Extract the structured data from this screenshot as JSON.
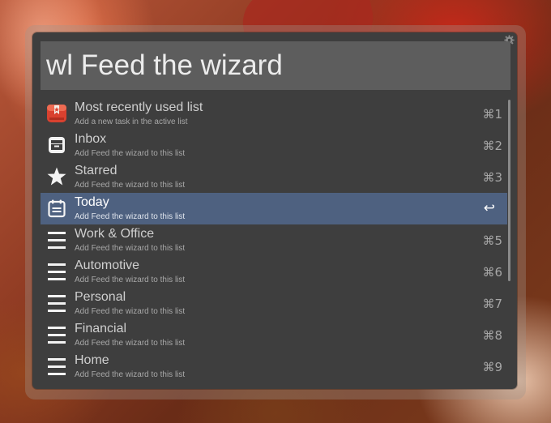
{
  "search": {
    "value": "wl Feed the wizard"
  },
  "icons": {
    "gear": "gear-icon",
    "enter": "↩"
  },
  "results": [
    {
      "title": "Most recently used list",
      "subtitle": "Add a new task in the active list",
      "shortcut": "⌘1",
      "icon": "wunderlist-app-icon"
    },
    {
      "title": "Inbox",
      "subtitle": "Add Feed the wizard to this list",
      "shortcut": "⌘2",
      "icon": "inbox-icon"
    },
    {
      "title": "Starred",
      "subtitle": "Add Feed the wizard to this list",
      "shortcut": "⌘3",
      "icon": "star-icon"
    },
    {
      "title": "Today",
      "subtitle": "Add Feed the wizard to this list",
      "shortcut": "↩",
      "icon": "calendar-icon",
      "selected": true
    },
    {
      "title": "Work & Office",
      "subtitle": "Add Feed the wizard to this list",
      "shortcut": "⌘5",
      "icon": "list-icon"
    },
    {
      "title": "Automotive",
      "subtitle": "Add Feed the wizard to this list",
      "shortcut": "⌘6",
      "icon": "list-icon"
    },
    {
      "title": "Personal",
      "subtitle": "Add Feed the wizard to this list",
      "shortcut": "⌘7",
      "icon": "list-icon"
    },
    {
      "title": "Financial",
      "subtitle": "Add Feed the wizard to this list",
      "shortcut": "⌘8",
      "icon": "list-icon"
    },
    {
      "title": "Home",
      "subtitle": "Add Feed the wizard to this list",
      "shortcut": "⌘9",
      "icon": "list-icon"
    }
  ],
  "colors": {
    "panel": "#3e3e3e",
    "search_field": "#5d5d5d",
    "selection": "#4e6180",
    "app_icon_red": "#d9412f"
  }
}
